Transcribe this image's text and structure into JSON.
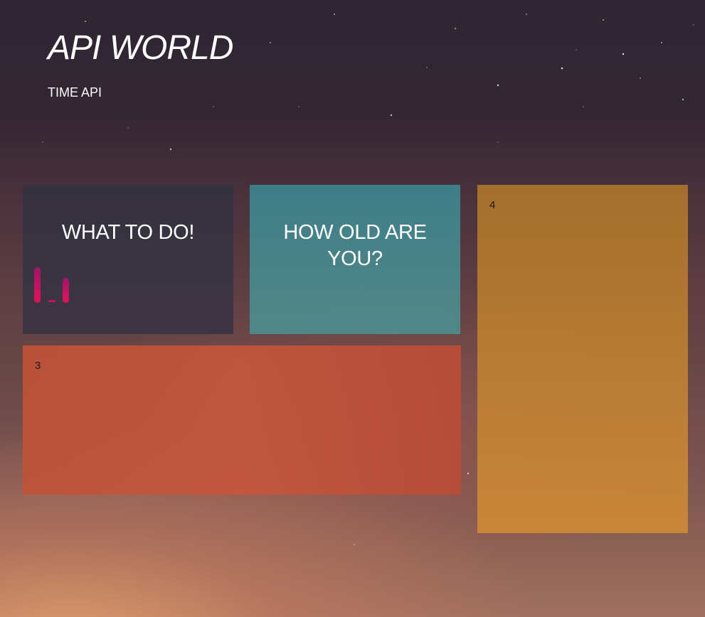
{
  "header": {
    "title": "API WORLD",
    "subtitle": "TIME API"
  },
  "cards": {
    "todo": {
      "heading": "WHAT TO DO!"
    },
    "age": {
      "heading": "HOW OLD ARE YOU?"
    },
    "three": {
      "number": "3"
    },
    "four": {
      "number": "4"
    }
  },
  "colors": {
    "todo_card": "#34323f",
    "age_card": "#4a8a8e",
    "card_three": "#c0533b",
    "card_four": "#b57a33",
    "loader_accent": "#e3135a"
  },
  "icons": {
    "loader": "loading-bars-icon"
  }
}
